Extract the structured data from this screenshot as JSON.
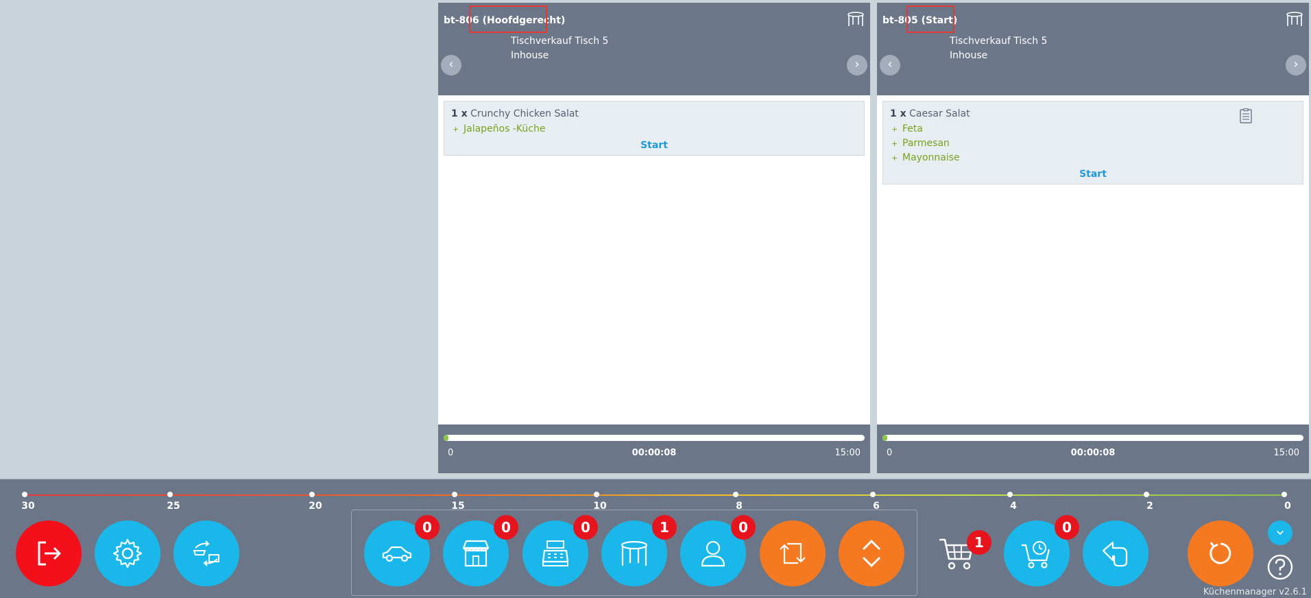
{
  "orders": [
    {
      "title": "bt-806 (Hoofdgerecht)",
      "line1": "Tischverkauf Tisch 5",
      "line2": "Inhouse",
      "nav_prev": "‹",
      "nav_next": "›",
      "items": [
        {
          "qty": "1 x",
          "name": "Crunchy Chicken Salat",
          "modifiers": [
            "Jalapeños -Küche"
          ],
          "action": "Start"
        }
      ],
      "progress": {
        "start": "0",
        "elapsed": "00:00:08",
        "end": "15:00",
        "fraction": 0.01
      }
    },
    {
      "title": "bt-805 (Start)",
      "line1": "Tischverkauf Tisch 5",
      "line2": "Inhouse",
      "nav_prev": "‹",
      "nav_next": "›",
      "items": [
        {
          "qty": "1 x",
          "name": "Caesar Salat",
          "modifiers": [
            "Feta",
            "Parmesan",
            "Mayonnaise"
          ],
          "action": "Start"
        }
      ],
      "progress": {
        "start": "0",
        "elapsed": "00:00:08",
        "end": "15:00",
        "fraction": 0.01
      }
    }
  ],
  "timeline": {
    "labels": [
      "30",
      "25",
      "20",
      "15",
      "10",
      "8",
      "6",
      "4",
      "2",
      "0"
    ]
  },
  "toolbar": {
    "delivery_badge": "0",
    "store_badge": "0",
    "register_badge": "0",
    "table_badge": "1",
    "user_badge": "0",
    "cart_badge": "1",
    "timed_cart_badge": "0"
  },
  "colors": {
    "logout": "#f4101a",
    "primary": "#1ab8ea",
    "orange": "#f47920",
    "badge": "#e8141d"
  },
  "icons": [
    "logout-icon",
    "gear-icon",
    "kitchen-swap-icon",
    "car-icon",
    "store-icon",
    "cash-register-icon",
    "table-icon",
    "user-icon",
    "swap-arrows-icon",
    "expand-collapse-icon",
    "cart-icon",
    "timed-cart-icon",
    "hand-pointer-icon",
    "refresh-icon",
    "chevron-down-icon",
    "help-icon",
    "recipe-icon"
  ],
  "version": "Küchenmanager v2.6.1"
}
